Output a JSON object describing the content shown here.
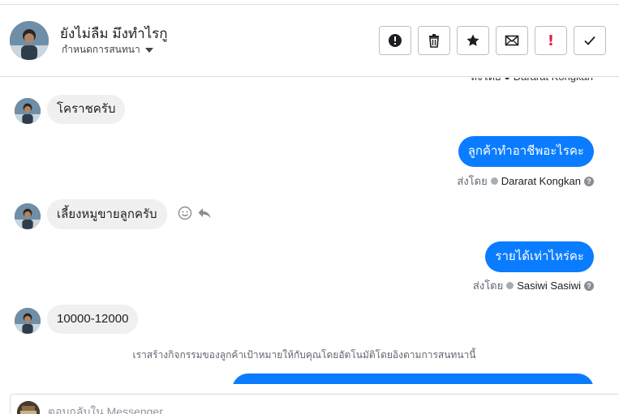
{
  "header": {
    "contact_name": "ยังไม่ลืม มึงทำไรกู",
    "subtitle": "กำหนดการสนทนา",
    "actions": [
      {
        "name": "spam-button",
        "icon": "exclamation-circle-icon"
      },
      {
        "name": "delete-button",
        "icon": "trash-icon"
      },
      {
        "name": "star-button",
        "icon": "star-icon"
      },
      {
        "name": "mark-unread-button",
        "icon": "envelope-icon"
      },
      {
        "name": "important-button",
        "icon": "exclamation-icon",
        "color": "#e41e3f"
      },
      {
        "name": "done-button",
        "icon": "checkmark-icon"
      }
    ]
  },
  "thread": {
    "cut_meta": "ส่งโดย ● Dararat Kongkan",
    "messages": [
      {
        "from": "customer",
        "text": "โคราชครับ"
      },
      {
        "from": "page",
        "text": "ลูกค้าทำอาชีพอะไรคะ",
        "sent_by_label": "ส่งโดย",
        "sender": "Dararat Kongkan"
      },
      {
        "from": "customer",
        "text": "เลี้ยงหมูขายลูกครับ"
      },
      {
        "from": "page",
        "text": "รายได้เท่าไหร่คะ",
        "sent_by_label": "ส่งโดย",
        "sender": "Sasiwi Sasiwi"
      },
      {
        "from": "customer",
        "text": "10000-12000"
      }
    ],
    "system_note": "เราสร้างกิจกรรมของลูกค้าเป้าหมายให้กับคุณโดยอัตโนมัติโดยอิงตามการสนทนานี้",
    "help_mark": "?"
  },
  "composer": {
    "placeholder": "ตอบกลับใน Messenger"
  },
  "colors": {
    "accent": "#0a7cff",
    "incoming_bubble": "#f0f0f0",
    "important": "#e41e3f"
  }
}
